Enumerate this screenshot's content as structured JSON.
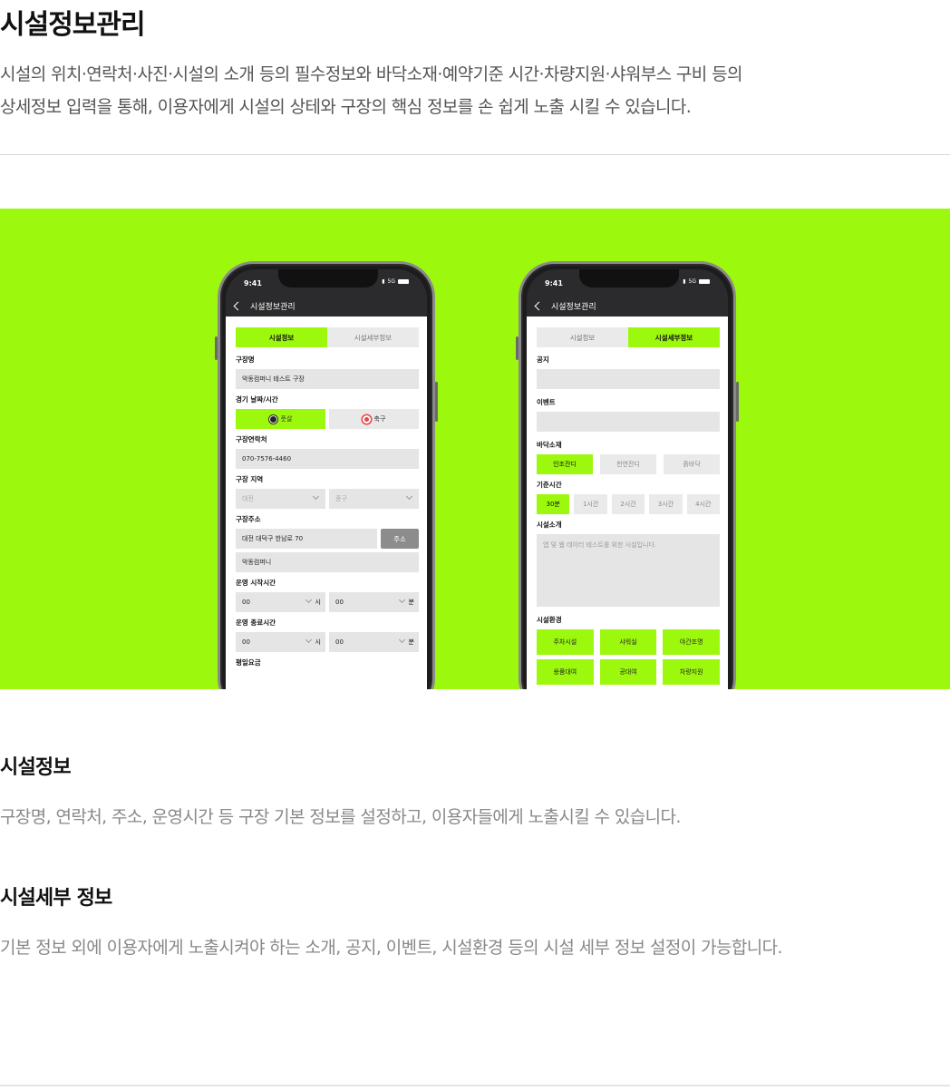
{
  "header": {
    "title": "시설정보관리",
    "intro_line1": "시설의 위치·연락처·사진·시설의 소개 등의 필수정보와 바닥소재·예약기준 시간·차량지원·샤워부스 구비 등의",
    "intro_line2": "상세정보  입력을 통해, 이용자에게 시설의 상테와 구장의 핵심 정보를 손 쉽게 노출 시킬 수 있습니다."
  },
  "colors": {
    "accent": "#9cf80d"
  },
  "phone_left": {
    "time": "9:41",
    "network": "5G",
    "appbar_title": "시설정보관리",
    "tabs": [
      "시설정보",
      "시설세부정보"
    ],
    "active_tab": 0,
    "fields": {
      "name_label": "구장명",
      "name_value": "악동컴퍼니 테스트 구장",
      "sport_label": "경기 날짜/시간",
      "sport_futsal": "풋살",
      "sport_soccer": "축구",
      "phone_label": "구장연락처",
      "phone_value": "070-7576-4460",
      "region_label": "구장 지역",
      "region_city": "대전",
      "region_district": "중구",
      "address_label": "구장주소",
      "address_value": "대전 대덕구 한남로 70",
      "address_button": "주소",
      "address_detail": "악동컴퍼니",
      "open_label": "운영 시작시간",
      "open_hour": "00",
      "open_hour_unit": "시",
      "open_min": "00",
      "open_min_unit": "분",
      "close_label": "운영 종료시간",
      "close_hour": "00",
      "close_hour_unit": "시",
      "close_min": "00",
      "close_min_unit": "분",
      "price_label": "평일요금"
    }
  },
  "phone_right": {
    "time": "9:41",
    "network": "5G",
    "appbar_title": "시설정보관리",
    "tabs": [
      "시설정보",
      "시설세부정보"
    ],
    "active_tab": 1,
    "notice_label": "공지",
    "event_label": "이벤트",
    "floor_label": "바닥소재",
    "floor_options": [
      "인조잔디",
      "천연잔디",
      "흙바닥"
    ],
    "time_label": "기준시간",
    "time_options": [
      "30분",
      "1시간",
      "2시간",
      "3시간",
      "4시간"
    ],
    "intro_label": "시설소개",
    "intro_placeholder": "앱 및 웹 데이터 테스트를 위한 시설입니다.",
    "env_label": "시설환경",
    "env_options": [
      "주차시설",
      "샤워실",
      "야간조명",
      "용품대여",
      "공대여",
      "차량지원"
    ]
  },
  "sections": [
    {
      "title": "시설정보",
      "desc": "구장명, 연락처, 주소, 운영시간 등 구장 기본 정보를 설정하고, 이용자들에게 노출시킬 수 있습니다."
    },
    {
      "title": "시설세부 정보",
      "desc": "기본 정보 외에 이용자에게 노출시켜야 하는 소개, 공지, 이벤트, 시설환경 등의 시설 세부 정보 설정이 가능합니다."
    }
  ]
}
